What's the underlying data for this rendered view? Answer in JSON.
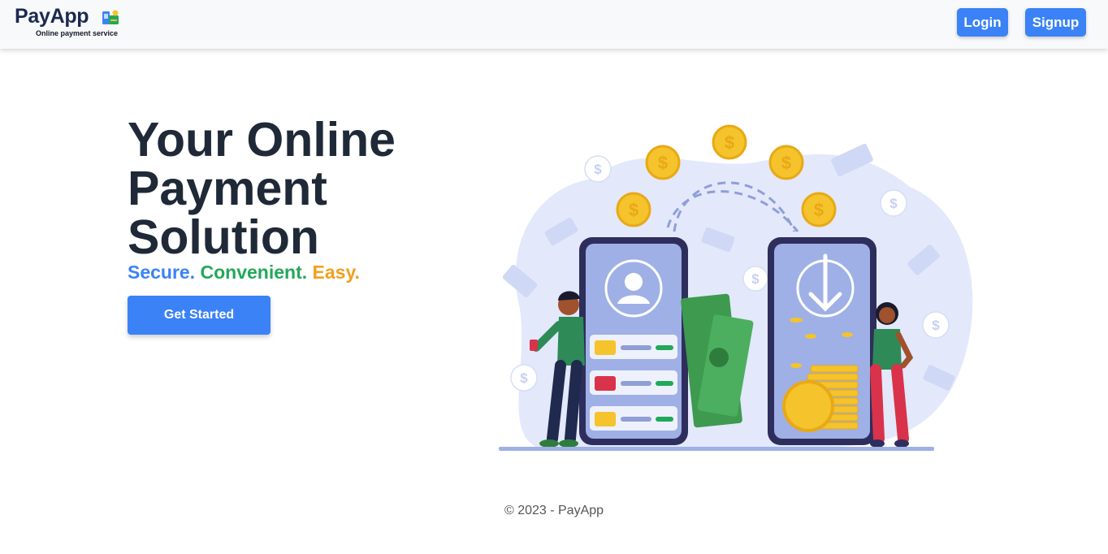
{
  "navbar": {
    "brand_name": "PayApp",
    "brand_subtitle": "Online payment service",
    "login_label": "Login",
    "signup_label": "Signup"
  },
  "hero": {
    "title": "Your Online Payment Solution",
    "tagline": {
      "part1": "Secure.",
      "part2": "Convenient.",
      "part3": "Easy."
    },
    "cta_label": "Get Started"
  },
  "illustration": {
    "icon": "mobile-payment-illustration"
  },
  "footer": {
    "copyright": "© 2023 - PayApp"
  },
  "colors": {
    "accent": "#3b82f6",
    "secure": "#3b82f6",
    "convenient": "#22a85a",
    "easy": "#f0a020",
    "heading": "#1f2937"
  }
}
